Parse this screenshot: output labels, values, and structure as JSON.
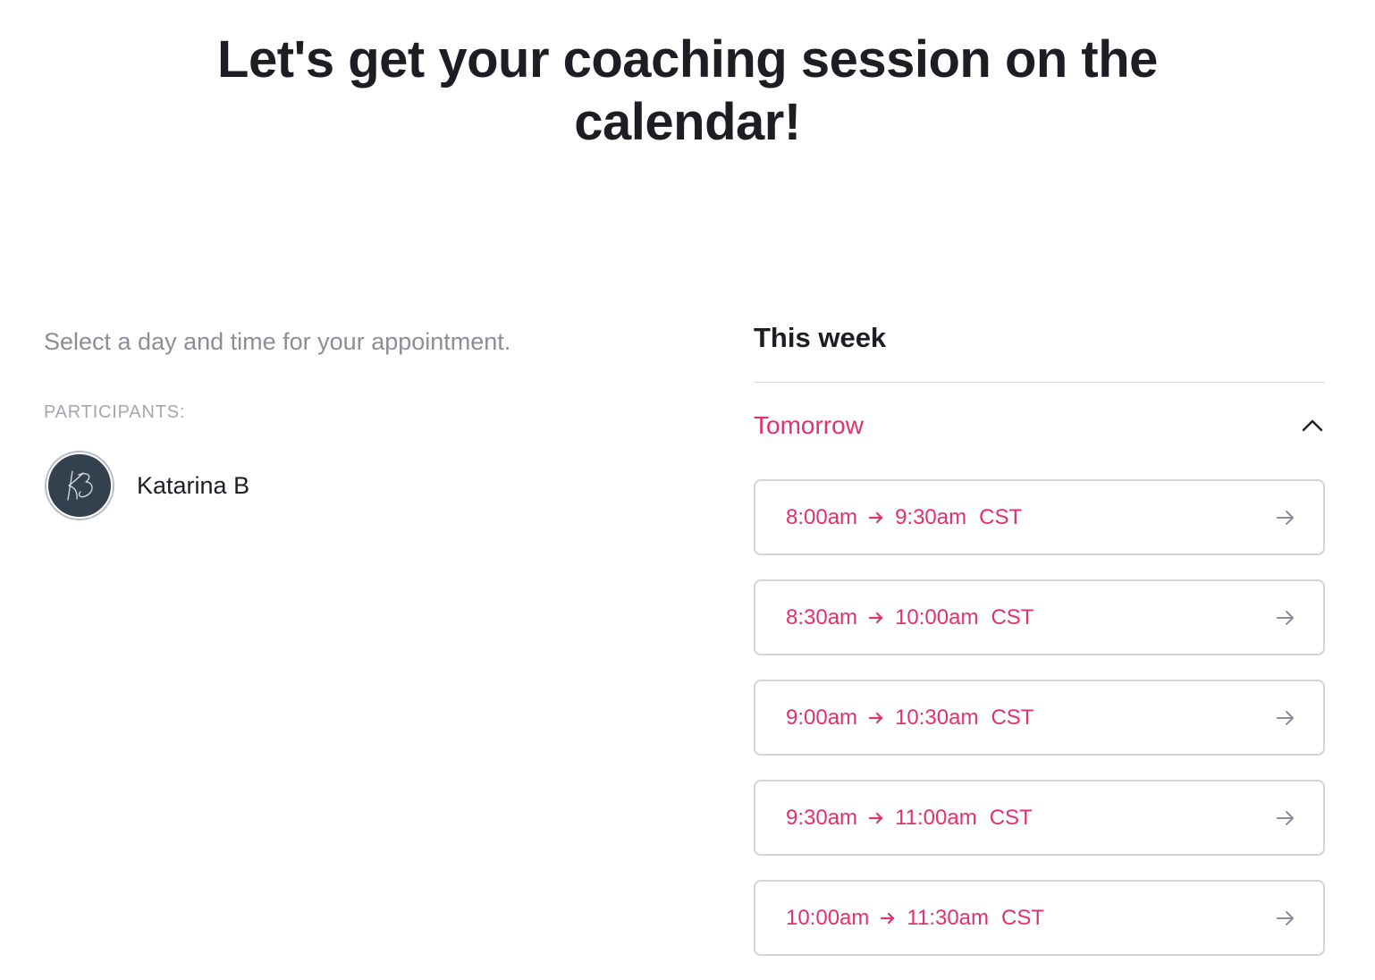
{
  "page": {
    "title_line1": "Let's get your coaching session on the",
    "title_line2": "calendar!"
  },
  "left": {
    "instructions": "Select a day and time for your appointment.",
    "participants_label": "PARTICIPANTS:",
    "participant": {
      "name": "Katarina B",
      "avatar_monogram": "KB",
      "avatar_icon": "signature-monogram-icon"
    }
  },
  "schedule": {
    "week_heading": "This week",
    "day": {
      "label": "Tomorrow",
      "toggle_icon": "chevron-up-icon",
      "expanded": true
    },
    "slots": [
      {
        "start": "8:00am",
        "end": "9:30am",
        "tz": "CST"
      },
      {
        "start": "8:30am",
        "end": "10:00am",
        "tz": "CST"
      },
      {
        "start": "9:00am",
        "end": "10:30am",
        "tz": "CST"
      },
      {
        "start": "9:30am",
        "end": "11:00am",
        "tz": "CST"
      },
      {
        "start": "10:00am",
        "end": "11:30am",
        "tz": "CST"
      }
    ]
  },
  "colors": {
    "accent": "#e0336a",
    "text": "#1d1d24",
    "muted": "#8e8d97",
    "border": "#d4d3da",
    "avatar_bg": "#33414f"
  }
}
